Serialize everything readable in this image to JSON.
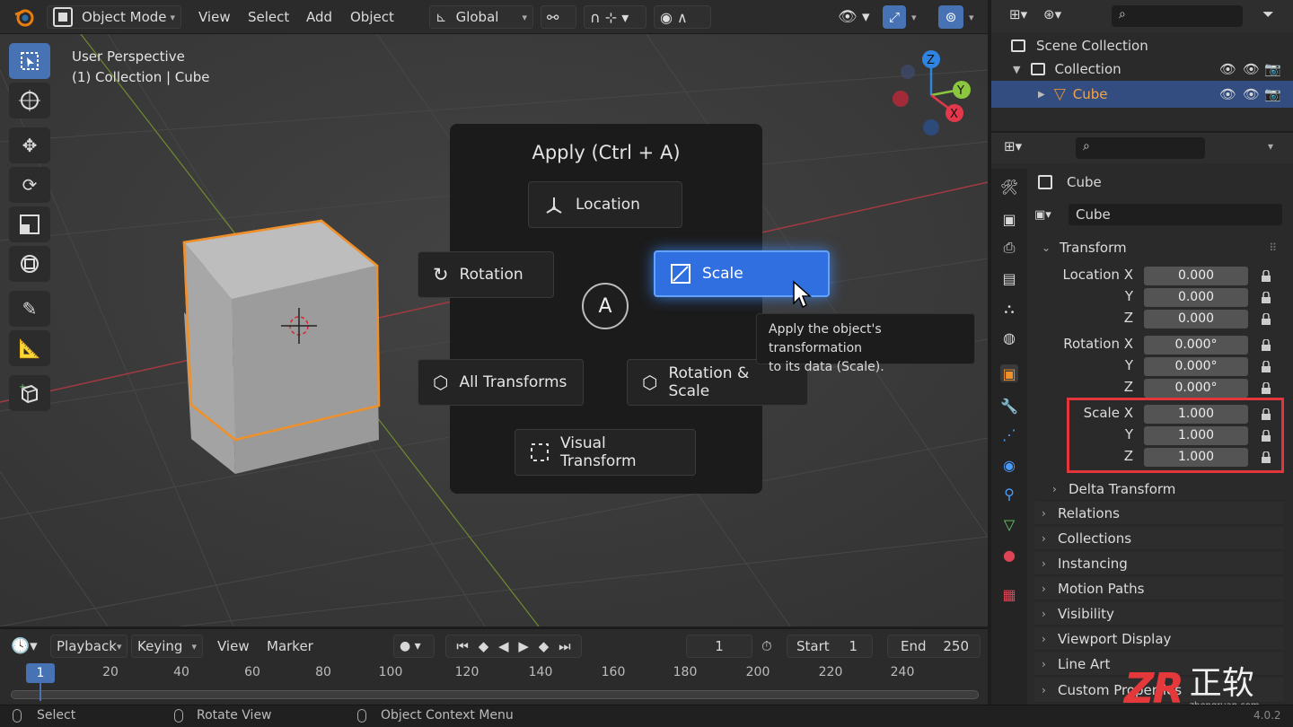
{
  "topbar": {
    "mode": "Object Mode",
    "menus": [
      "View",
      "Select",
      "Add",
      "Object"
    ],
    "orientation": "Global"
  },
  "viewport": {
    "hud_line1": "User Perspective",
    "hud_line2": "(1) Collection | Cube",
    "gizmo_axes": {
      "x": "X",
      "y": "Y",
      "z": "Z"
    },
    "axis_colors": {
      "x": "#e3384b",
      "y": "#8cc63f",
      "z": "#2f84e0"
    }
  },
  "pie_menu": {
    "title": "Apply  (Ctrl + A)",
    "center": "A",
    "items": {
      "location": "Location",
      "rotation": "Rotation",
      "scale": "Scale",
      "all_transforms": "All Transforms",
      "rotation_scale": "Rotation & Scale",
      "visual_transform": "Visual Transform"
    },
    "tooltip_line1": "Apply the object's transformation",
    "tooltip_line2": "to its data (Scale)."
  },
  "outliner": {
    "scene_collection": "Scene Collection",
    "collection": "Collection",
    "cube": "Cube"
  },
  "properties": {
    "object_name": "Cube",
    "data_name": "Cube",
    "transform_header": "Transform",
    "location_label": "Location X",
    "rotation_label": "Rotation X",
    "scale_label": "Scale X",
    "axis_y": "Y",
    "axis_z": "Z",
    "location": [
      "0.000",
      "0.000",
      "0.000"
    ],
    "rotation": [
      "0.000°",
      "0.000°",
      "0.000°"
    ],
    "scale": [
      "1.000",
      "1.000",
      "1.000"
    ],
    "sections": [
      "Delta Transform",
      "Relations",
      "Collections",
      "Instancing",
      "Motion Paths",
      "Visibility",
      "Viewport Display",
      "Line Art",
      "Custom Properties"
    ]
  },
  "timeline": {
    "menus": [
      "Playback",
      "Keying",
      "View",
      "Marker"
    ],
    "current_frame": "1",
    "start_label": "Start",
    "start_value": "1",
    "end_label": "End",
    "end_value": "250",
    "ruler_current": "1",
    "ruler_ticks": [
      "20",
      "40",
      "60",
      "80",
      "100",
      "120",
      "140",
      "160",
      "180",
      "200",
      "220",
      "240"
    ]
  },
  "statusbar": {
    "select": "Select",
    "rotate": "Rotate View",
    "context": "Object Context Menu",
    "version": "4.0.2"
  },
  "watermark": {
    "logo": "ZR",
    "chinese": "正软",
    "url": "zhengruan.com"
  }
}
